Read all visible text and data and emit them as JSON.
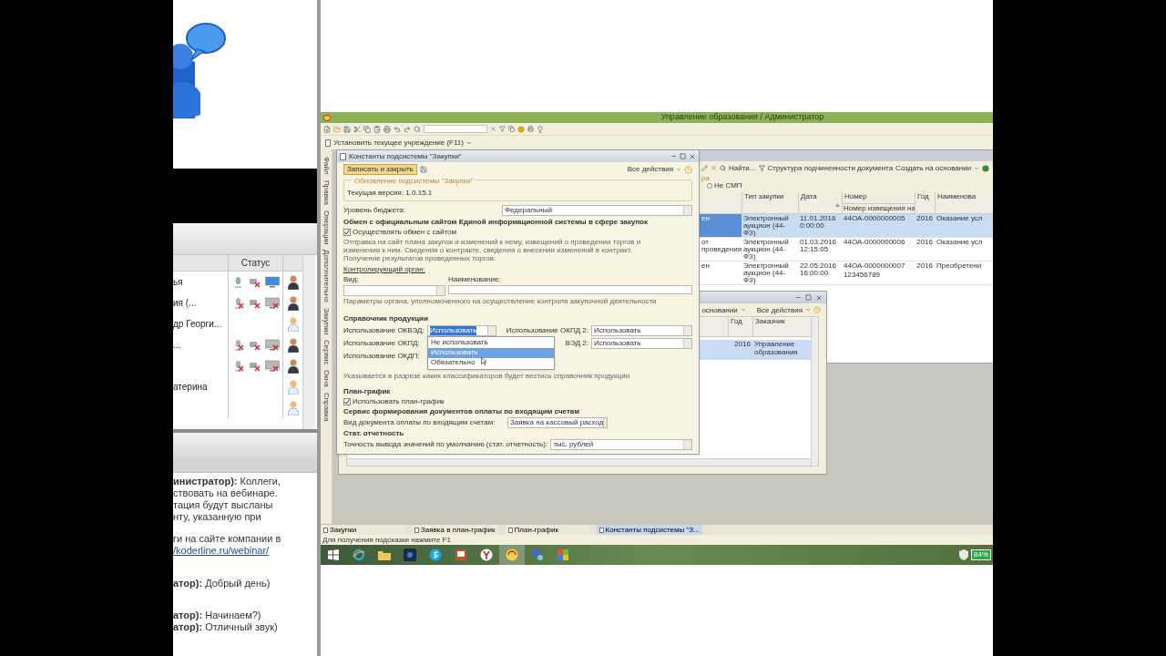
{
  "webinar": {
    "participants": {
      "columns": [
        "Статус"
      ],
      "rows": [
        {
          "name": "ья",
          "kind": "active"
        },
        {
          "name": "ия (...",
          "kind": "speaker"
        },
        {
          "name": "др Георги...",
          "kind": "listener"
        },
        {
          "name": "...",
          "kind": "speaker"
        },
        {
          "kind": "speaker"
        },
        {
          "name": "атерина",
          "kind": "listener"
        },
        {
          "kind": "listener"
        }
      ]
    },
    "chat": [
      {
        "lines": [
          "**инистратор):** Коллеги,",
          "ствовать на вебинаре.",
          "тация будут высланы",
          "нту, указанную при"
        ]
      },
      {
        "lines": [
          "ги на сайте компании в"
        ],
        "link": "/koderline.ru/webinar/"
      },
      {
        "lines": [
          "**атор):** Добрый день)"
        ]
      },
      {
        "lines": [
          "**атор):** Начинаем?)",
          "**атор):** Отличный звук)"
        ]
      }
    ]
  },
  "app": {
    "title": "Управление образования / Администратор",
    "command": "Установить текущее учреждение (F11)",
    "sections": [
      "Файл",
      "Правка",
      "Операции",
      "Дополнительно",
      "Закупки",
      "Сервис",
      "Окна",
      "Справка"
    ],
    "dialog": {
      "title": "Константы подсистемы \"Закупки\"",
      "save_button": "Записать и закрыть",
      "actions": "Все действия",
      "update_group": {
        "title": "Обновление подсистемы \"Закупки\"",
        "version": "Текущая версия: 1.0.15.1"
      },
      "budget_level": {
        "label": "Уровень бюджета:",
        "value": "Федеральный"
      },
      "exchange": {
        "heading": "Обмен с официальным сайтом Единой информационной системы в сфере закупок",
        "checkbox": {
          "label": "Осуществлять обмен с сайтом",
          "checked": true
        },
        "description": [
          "Отправка на сайт плана закупок и изменений к нему, извещений о проведении торгов и",
          "изменения к ним. Сведения о контракте, сведения о внесении изменений в контракт.",
          "Получение результатов проведенных торгов."
        ],
        "control_link": "Контролирующий орган:",
        "kind_label": "Вид:",
        "name_label": "Наименование:",
        "hint": "Параметры органа, уполномоченного на осуществление контроля закупочной деятельности"
      },
      "products": {
        "heading": "Справочник продукции",
        "fields": [
          {
            "label": "Использование ОКВЭД:",
            "value": "Использовать",
            "selected": true
          },
          {
            "label": "Использование ОКПД:"
          },
          {
            "label": "Использование ОКДП:"
          }
        ],
        "fields_right": [
          {
            "label": "Использование ОКПД 2:",
            "value": "Использовать"
          },
          {
            "label": "ВЭД 2:",
            "value": "Использовать"
          }
        ],
        "dropdown": [
          {
            "label": "Не использовать",
            "selected": false
          },
          {
            "label": "Использовать",
            "selected": true
          },
          {
            "label": "Обязательно",
            "selected": false
          }
        ],
        "hint": "Указывается в разрезе каких классификаторов будет вестись справочник продукции"
      },
      "schedule": {
        "heading": "План-график",
        "checkbox": {
          "label": "Использовать план-график",
          "checked": true
        }
      },
      "payment": {
        "heading": "Сервис формирования документов оплаты по входящим счетам",
        "label": "Вид документа оплаты по входящим счетам:",
        "value": "Заявка на кассовый расход"
      },
      "stats": {
        "heading": "Стат. отчетность",
        "label": "Точность вывода значений по умолчанию (стат. отчетность):",
        "value": "тыс. рублей"
      }
    },
    "list_window": {
      "find": "Найти...",
      "structure": "Структура подчиненности документа",
      "create": "Создать на основании",
      "group_title": "ра",
      "radio": {
        "label": "Не СМП",
        "selected": false
      },
      "columns": [
        {},
        {
          "label": "Тип закупки"
        },
        {
          "label": "Дата",
          "sorted": true
        },
        {
          "label": "Номер",
          "sub": "Номер извещения на"
        },
        {
          "label": "Год"
        },
        {
          "label": "Наименова"
        }
      ],
      "rows": [
        {
          "cells": [
            "ен",
            "Электронный аукцион (44-ФЗ)",
            "11.01.2016 0:00:00",
            "44ОА-0000000005",
            "2016",
            "Оказание усл"
          ],
          "selected": true
        },
        {
          "cells": [
            "от проведения",
            "Электронный аукцион (44-ФЗ)",
            "01.03.2016 12:15:05",
            "44ОА-0000000006",
            "2016",
            "Оказание усл"
          ],
          "selected": false
        },
        {
          "cells": [
            "ен",
            "Электронный аукцион (44-ФЗ)",
            "22.05.2016 16:00:00",
            "44ОА-0000000007",
            "2016",
            "Преобретени"
          ],
          "extra": "123456789",
          "selected": false
        }
      ]
    },
    "sub_window": {
      "create": "основании",
      "actions": "Все действия",
      "columns": [
        "Год",
        "Заказчик"
      ],
      "rows": [
        {
          "cells": [
            "2016",
            "Управление образования"
          ],
          "selected": true
        }
      ]
    },
    "window_tabs": [
      {
        "label": "Закупки",
        "selected": false
      },
      {
        "label": "Заявка в план-график",
        "selected": false
      },
      {
        "label": "План-график",
        "selected": false
      },
      {
        "label": "Константы подсистемы \"З...",
        "selected": true
      }
    ],
    "status_bar": "Для получения подсказки нажмите F1",
    "taskbar": {
      "battery": "84%"
    }
  }
}
